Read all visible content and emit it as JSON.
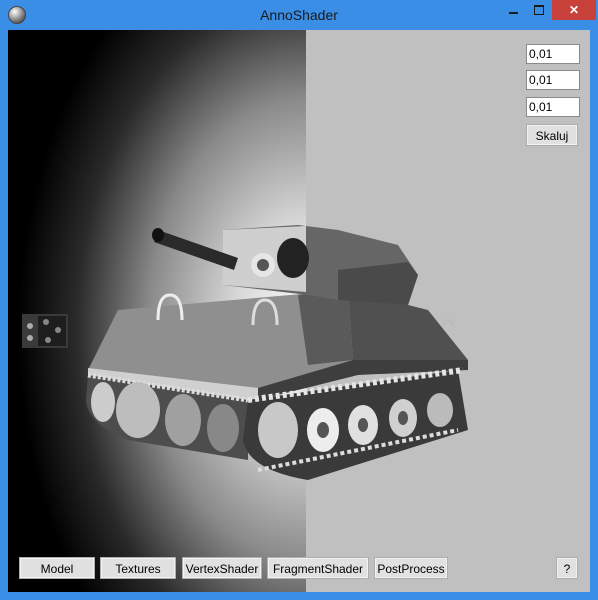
{
  "window": {
    "title": "AnnoShader",
    "close_symbol": "✕"
  },
  "scale_panel": {
    "x_value": "0,01",
    "y_value": "0,01",
    "z_value": "0,01",
    "scale_button": "Skaluj"
  },
  "toolbar": {
    "model": "Model",
    "textures": "Textures",
    "vertex_shader": "VertexShader",
    "fragment_shader": "FragmentShader",
    "post_process": "PostProcess",
    "help": "?"
  }
}
